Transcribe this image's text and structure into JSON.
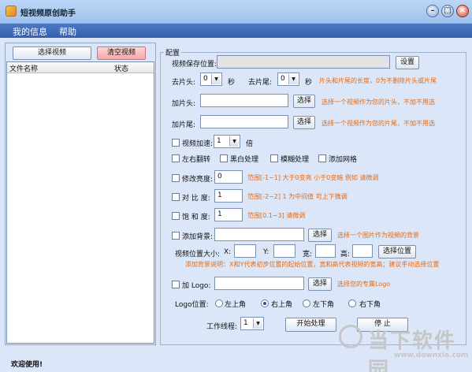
{
  "window": {
    "title": "短视频原创助手"
  },
  "menu": [
    "我的信息",
    "帮助"
  ],
  "left": {
    "select_btn": "选择视频",
    "clear_btn": "清空视频",
    "columns": [
      "文件名称",
      "状态"
    ]
  },
  "config": {
    "group_title": "配置",
    "save_label": "视频保存位置:",
    "save_value": "",
    "settings_btn": "设置",
    "trim_head_label": "去片头:",
    "trim_head_value": "0",
    "trim_tail_label": "去片尾:",
    "trim_tail_value": "0",
    "sec": "秒",
    "trim_hint": "片头和片尾的长度，0为不删除片头或片尾",
    "add_head_label": "加片头:",
    "add_tail_label": "加片尾:",
    "choose": "选择",
    "add_hint": "选择一个视频作为您的片头，不加不用选",
    "add_tail_hint": "选择一个视频作为您的片尾，不加不用选",
    "speed_label": "视频加速:",
    "speed_value": "1",
    "speed_unit": "倍",
    "flip": "左右翻转",
    "bw": "黑白处理",
    "blur": "模糊处理",
    "grid": "添加网格",
    "brightness_label": "修改亮度:",
    "brightness_value": "0",
    "brightness_hint": "范围[-1~1]  大于0变亮 小于0变暗  例如 请微调",
    "contrast_label": "对 比 度:",
    "contrast_value": "1",
    "contrast_hint": "范围[-2~2]  1 为中间值  可上下微调",
    "saturation_label": "饱 和 度:",
    "saturation_value": "1",
    "saturation_hint": "范围[0.1~3]  请微调",
    "bg_label": "添加背景:",
    "bg_hint": "选择一个图片作为视频的背景",
    "pos_label": "视频位置大小:",
    "x": "X:",
    "y": "Y:",
    "w": "宽:",
    "h": "高:",
    "choose_pos": "选择位置",
    "bg_note": "添加背景说明：X和Y代表初步位置的起始位置，宽和高代表视频的宽高；建议手动选择位置",
    "logo_label": "加 Logo:",
    "logo_hint": "选择您的专属Logo",
    "logo_pos_label": "Logo位置:",
    "logo_positions": [
      "左上角",
      "右上角",
      "左下角",
      "右下角"
    ],
    "logo_selected": "右上角",
    "threads_label": "工作线程:",
    "threads_value": "1",
    "start_btn": "开始处理",
    "stop_btn": "停    止"
  },
  "status": "欢迎使用!",
  "watermark": {
    "brand": "当下软件园",
    "url": "www.downxia.com"
  }
}
